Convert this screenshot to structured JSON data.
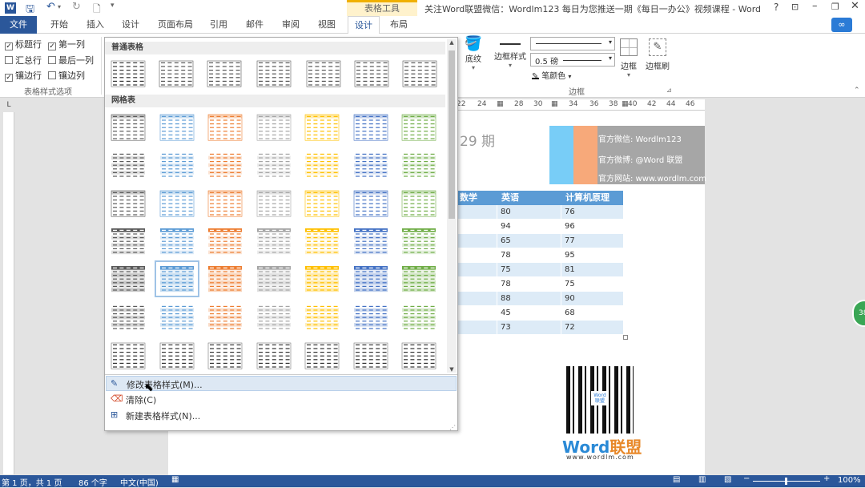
{
  "window": {
    "title": "关注Word联盟微信：Wordlm123    每日为您推送一期《每日一办公》视频课程 - Word",
    "context_tab_group": "表格工具",
    "help": "?"
  },
  "ribbon_tabs": [
    "文件",
    "开始",
    "插入",
    "设计",
    "页面布局",
    "引用",
    "邮件",
    "审阅",
    "视图",
    "设计",
    "布局"
  ],
  "table_style_options": {
    "items": [
      {
        "label": "标题行",
        "checked": true
      },
      {
        "label": "第一列",
        "checked": true
      },
      {
        "label": "汇总行",
        "checked": false
      },
      {
        "label": "最后一列",
        "checked": false
      },
      {
        "label": "镶边行",
        "checked": true
      },
      {
        "label": "镶边列",
        "checked": false
      }
    ],
    "group_label": "表格样式选项"
  },
  "borders_group": {
    "shading": "底纹",
    "border_styles": "边框样式",
    "pen_weight": "0.5 磅",
    "pen_color": "笔颜色",
    "borders": "边框",
    "border_painter": "边框刷",
    "group_label": "边框"
  },
  "gallery": {
    "section_plain": "普通表格",
    "section_grid": "网格表",
    "menu": [
      {
        "label": "修改表格样式(M)..."
      },
      {
        "label": "清除(C)"
      },
      {
        "label": "新建表格样式(N)..."
      }
    ],
    "grid_colors": [
      "#5a5a5a",
      "#5b9bd5",
      "#ed7d31",
      "#a5a5a5",
      "#ffc000",
      "#4472c4",
      "#70ad47"
    ],
    "selected_row": 4,
    "selected_col": 1
  },
  "ruler": {
    "labels": [
      "22",
      "24",
      "28",
      "30",
      "34",
      "36",
      "38",
      "40",
      "42",
      "44",
      "46"
    ]
  },
  "document": {
    "issue_text": "29 期",
    "info": [
      "官方微信: Wordlm123",
      "官方微博: @Word 联盟",
      "官方网站: www.wordlm.com"
    ],
    "table_headers": [
      "数学",
      "英语",
      "计算机原理"
    ],
    "table_rows": [
      {
        "en": "80",
        "cs": "76"
      },
      {
        "en": "94",
        "cs": "96"
      },
      {
        "en": "65",
        "cs": "77"
      },
      {
        "en": "78",
        "cs": "95"
      },
      {
        "en": "75",
        "cs": "81"
      },
      {
        "en": "78",
        "cs": "75"
      },
      {
        "en": "88",
        "cs": "90"
      },
      {
        "en": "45",
        "cs": "68"
      },
      {
        "en": "73",
        "cs": "72"
      }
    ],
    "logo_main": "Word",
    "logo_suffix": "联盟",
    "logo_url": "www.wordlm.com"
  },
  "status": {
    "pages": "第 1 页，共 1 页",
    "words": "86 个字",
    "language": "中文(中国)",
    "zoom": "100%"
  },
  "colors": {
    "accent": "#2b579a",
    "table_header": "#5b9bd5",
    "table_band": "#ddebf7",
    "cyan_block": "#78cdf7",
    "orange_block": "#f7a97a"
  }
}
